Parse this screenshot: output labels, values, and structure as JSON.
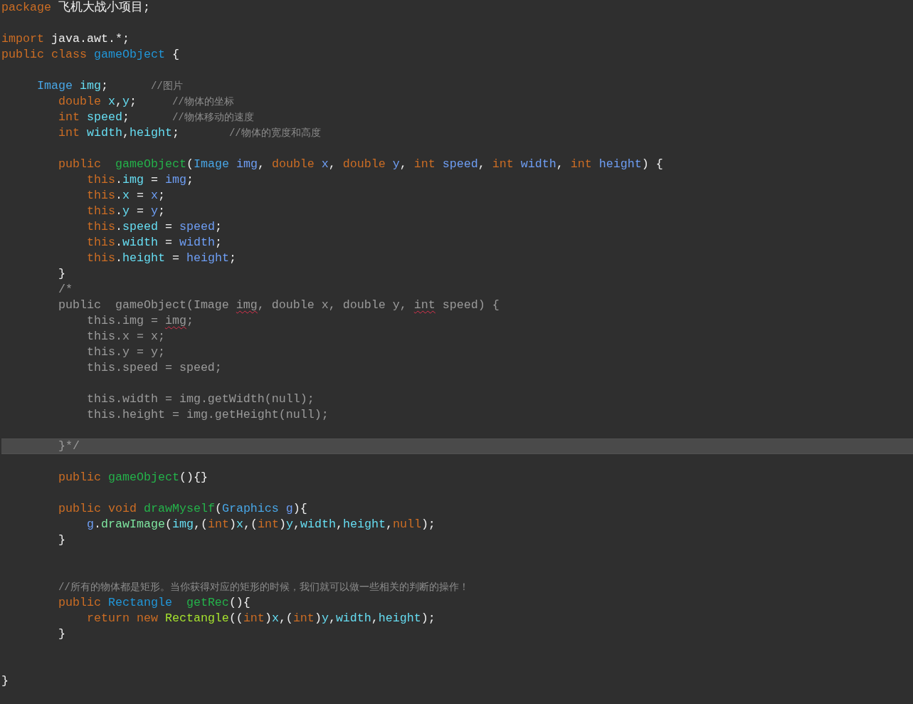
{
  "editor": {
    "lines": [
      {
        "current": false,
        "tokens": [
          {
            "text": "package ",
            "kind": "keyword"
          },
          {
            "text": "飞机大战小项目;",
            "kind": "plain"
          }
        ]
      },
      {
        "current": false
      },
      {
        "current": false,
        "tokens": [
          {
            "text": "import ",
            "kind": "keyword"
          },
          {
            "text": "java.awt.*;",
            "kind": "plain"
          }
        ]
      },
      {
        "current": false,
        "tokens": [
          {
            "text": "public class ",
            "kind": "keyword"
          },
          {
            "text": "gameObject ",
            "kind": "type"
          },
          {
            "text": "{",
            "kind": "plain"
          }
        ]
      },
      {
        "current": false
      },
      {
        "current": false,
        "tokens": [
          {
            "text": "     Image ",
            "kind": "type2"
          },
          {
            "text": "img",
            "kind": "field"
          },
          {
            "text": ";      ",
            "kind": "plain"
          },
          {
            "text": "//图片",
            "kind": "comment"
          }
        ]
      },
      {
        "current": false,
        "tokens": [
          {
            "text": "        double ",
            "kind": "keyword"
          },
          {
            "text": "x",
            "kind": "field"
          },
          {
            "text": ",",
            "kind": "plain"
          },
          {
            "text": "y",
            "kind": "field"
          },
          {
            "text": ";     ",
            "kind": "plain"
          },
          {
            "text": "//物体的坐标",
            "kind": "comment"
          }
        ]
      },
      {
        "current": false,
        "tokens": [
          {
            "text": "        int ",
            "kind": "keyword"
          },
          {
            "text": "speed",
            "kind": "field"
          },
          {
            "text": ";      ",
            "kind": "plain"
          },
          {
            "text": "//物体移动的速度",
            "kind": "comment"
          }
        ]
      },
      {
        "current": false,
        "tokens": [
          {
            "text": "        int ",
            "kind": "keyword"
          },
          {
            "text": "width",
            "kind": "field"
          },
          {
            "text": ",",
            "kind": "plain"
          },
          {
            "text": "height",
            "kind": "field"
          },
          {
            "text": ";       ",
            "kind": "plain"
          },
          {
            "text": "//物体的宽度和高度",
            "kind": "comment"
          }
        ]
      },
      {
        "current": false
      },
      {
        "current": false,
        "tokens": [
          {
            "text": "        public  ",
            "kind": "keyword"
          },
          {
            "text": "gameObject",
            "kind": "method"
          },
          {
            "text": "(",
            "kind": "plain"
          },
          {
            "text": "Image ",
            "kind": "type2"
          },
          {
            "text": "img",
            "kind": "param"
          },
          {
            "text": ", ",
            "kind": "plain"
          },
          {
            "text": "double ",
            "kind": "keyword"
          },
          {
            "text": "x",
            "kind": "param"
          },
          {
            "text": ", ",
            "kind": "plain"
          },
          {
            "text": "double ",
            "kind": "keyword"
          },
          {
            "text": "y",
            "kind": "param"
          },
          {
            "text": ", ",
            "kind": "plain"
          },
          {
            "text": "int ",
            "kind": "keyword"
          },
          {
            "text": "speed",
            "kind": "param"
          },
          {
            "text": ", ",
            "kind": "plain"
          },
          {
            "text": "int ",
            "kind": "keyword"
          },
          {
            "text": "width",
            "kind": "param"
          },
          {
            "text": ", ",
            "kind": "plain"
          },
          {
            "text": "int ",
            "kind": "keyword"
          },
          {
            "text": "height",
            "kind": "param"
          },
          {
            "text": ") {",
            "kind": "plain"
          }
        ]
      },
      {
        "current": false,
        "tokens": [
          {
            "text": "            this",
            "kind": "keyword"
          },
          {
            "text": ".",
            "kind": "plain"
          },
          {
            "text": "img",
            "kind": "field"
          },
          {
            "text": " = ",
            "kind": "plain"
          },
          {
            "text": "img",
            "kind": "param"
          },
          {
            "text": ";",
            "kind": "plain"
          }
        ]
      },
      {
        "current": false,
        "tokens": [
          {
            "text": "            this",
            "kind": "keyword"
          },
          {
            "text": ".",
            "kind": "plain"
          },
          {
            "text": "x",
            "kind": "field"
          },
          {
            "text": " = ",
            "kind": "plain"
          },
          {
            "text": "x",
            "kind": "param"
          },
          {
            "text": ";",
            "kind": "plain"
          }
        ]
      },
      {
        "current": false,
        "tokens": [
          {
            "text": "            this",
            "kind": "keyword"
          },
          {
            "text": ".",
            "kind": "plain"
          },
          {
            "text": "y",
            "kind": "field"
          },
          {
            "text": " = ",
            "kind": "plain"
          },
          {
            "text": "y",
            "kind": "param"
          },
          {
            "text": ";",
            "kind": "plain"
          }
        ]
      },
      {
        "current": false,
        "tokens": [
          {
            "text": "            this",
            "kind": "keyword"
          },
          {
            "text": ".",
            "kind": "plain"
          },
          {
            "text": "speed",
            "kind": "field"
          },
          {
            "text": " = ",
            "kind": "plain"
          },
          {
            "text": "speed",
            "kind": "param"
          },
          {
            "text": ";",
            "kind": "plain"
          }
        ]
      },
      {
        "current": false,
        "tokens": [
          {
            "text": "            this",
            "kind": "keyword"
          },
          {
            "text": ".",
            "kind": "plain"
          },
          {
            "text": "width",
            "kind": "field"
          },
          {
            "text": " = ",
            "kind": "plain"
          },
          {
            "text": "width",
            "kind": "param"
          },
          {
            "text": ";",
            "kind": "plain"
          }
        ]
      },
      {
        "current": false,
        "tokens": [
          {
            "text": "            this",
            "kind": "keyword"
          },
          {
            "text": ".",
            "kind": "plain"
          },
          {
            "text": "height",
            "kind": "field"
          },
          {
            "text": " = ",
            "kind": "plain"
          },
          {
            "text": "height",
            "kind": "param"
          },
          {
            "text": ";",
            "kind": "plain"
          }
        ]
      },
      {
        "current": false,
        "tokens": [
          {
            "text": "        }",
            "kind": "plain"
          }
        ]
      },
      {
        "current": false,
        "tokens": [
          {
            "text": "        /*",
            "kind": "block"
          }
        ]
      },
      {
        "current": false,
        "tokens": [
          {
            "text": "        public  gameObject(Image ",
            "kind": "block"
          },
          {
            "text": "img",
            "kind": "block",
            "misspelled": true
          },
          {
            "text": ", double x, double y, ",
            "kind": "block"
          },
          {
            "text": "int",
            "kind": "block",
            "misspelled": true
          },
          {
            "text": " speed) {",
            "kind": "block"
          }
        ]
      },
      {
        "current": false,
        "tokens": [
          {
            "text": "            this.img = ",
            "kind": "block"
          },
          {
            "text": "img",
            "kind": "block",
            "misspelled": true
          },
          {
            "text": ";",
            "kind": "block"
          }
        ]
      },
      {
        "current": false,
        "tokens": [
          {
            "text": "            this.x = x;",
            "kind": "block"
          }
        ]
      },
      {
        "current": false,
        "tokens": [
          {
            "text": "            this.y = y;",
            "kind": "block"
          }
        ]
      },
      {
        "current": false,
        "tokens": [
          {
            "text": "            this.speed = speed;",
            "kind": "block"
          }
        ]
      },
      {
        "current": false
      },
      {
        "current": false,
        "tokens": [
          {
            "text": "            this.width = img.getWidth(null);",
            "kind": "block"
          }
        ]
      },
      {
        "current": false,
        "tokens": [
          {
            "text": "            this.height = img.getHeight(null);",
            "kind": "block"
          }
        ]
      },
      {
        "current": false
      },
      {
        "current": true,
        "tokens": [
          {
            "text": "        }*/",
            "kind": "block"
          }
        ]
      },
      {
        "current": false
      },
      {
        "current": false,
        "tokens": [
          {
            "text": "        public ",
            "kind": "keyword"
          },
          {
            "text": "gameObject",
            "kind": "method"
          },
          {
            "text": "(){}",
            "kind": "plain"
          }
        ]
      },
      {
        "current": false
      },
      {
        "current": false,
        "tokens": [
          {
            "text": "        public void ",
            "kind": "keyword"
          },
          {
            "text": "drawMyself",
            "kind": "method"
          },
          {
            "text": "(",
            "kind": "plain"
          },
          {
            "text": "Graphics ",
            "kind": "type2"
          },
          {
            "text": "g",
            "kind": "param"
          },
          {
            "text": "){",
            "kind": "plain"
          }
        ]
      },
      {
        "current": false,
        "tokens": [
          {
            "text": "            g",
            "kind": "param"
          },
          {
            "text": ".",
            "kind": "plain"
          },
          {
            "text": "drawImage",
            "kind": "call"
          },
          {
            "text": "(",
            "kind": "plain"
          },
          {
            "text": "img",
            "kind": "field"
          },
          {
            "text": ",(",
            "kind": "plain"
          },
          {
            "text": "int",
            "kind": "keyword"
          },
          {
            "text": ")",
            "kind": "plain"
          },
          {
            "text": "x",
            "kind": "field"
          },
          {
            "text": ",(",
            "kind": "plain"
          },
          {
            "text": "int",
            "kind": "keyword"
          },
          {
            "text": ")",
            "kind": "plain"
          },
          {
            "text": "y",
            "kind": "field"
          },
          {
            "text": ",",
            "kind": "plain"
          },
          {
            "text": "width",
            "kind": "field"
          },
          {
            "text": ",",
            "kind": "plain"
          },
          {
            "text": "height",
            "kind": "field"
          },
          {
            "text": ",",
            "kind": "plain"
          },
          {
            "text": "null",
            "kind": "keyword"
          },
          {
            "text": ");",
            "kind": "plain"
          }
        ]
      },
      {
        "current": false,
        "tokens": [
          {
            "text": "        }",
            "kind": "plain"
          }
        ]
      },
      {
        "current": false
      },
      {
        "current": false
      },
      {
        "current": false,
        "tokens": [
          {
            "text": "        //所有的物体都是矩形。当你获得对应的矩形的时候，我们就可以做一些相关的判断的操作！",
            "kind": "comment"
          }
        ]
      },
      {
        "current": false,
        "tokens": [
          {
            "text": "        public ",
            "kind": "keyword"
          },
          {
            "text": "Rectangle  ",
            "kind": "type"
          },
          {
            "text": "getRec",
            "kind": "method"
          },
          {
            "text": "(){",
            "kind": "plain"
          }
        ]
      },
      {
        "current": false,
        "tokens": [
          {
            "text": "            return new ",
            "kind": "keyword"
          },
          {
            "text": "Rectangle",
            "kind": "ctor"
          },
          {
            "text": "((",
            "kind": "plain"
          },
          {
            "text": "int",
            "kind": "keyword"
          },
          {
            "text": ")",
            "kind": "plain"
          },
          {
            "text": "x",
            "kind": "field"
          },
          {
            "text": ",(",
            "kind": "plain"
          },
          {
            "text": "int",
            "kind": "keyword"
          },
          {
            "text": ")",
            "kind": "plain"
          },
          {
            "text": "y",
            "kind": "field"
          },
          {
            "text": ",",
            "kind": "plain"
          },
          {
            "text": "width",
            "kind": "field"
          },
          {
            "text": ",",
            "kind": "plain"
          },
          {
            "text": "height",
            "kind": "field"
          },
          {
            "text": ");",
            "kind": "plain"
          }
        ]
      },
      {
        "current": false,
        "tokens": [
          {
            "text": "        }",
            "kind": "plain"
          }
        ]
      },
      {
        "current": false
      },
      {
        "current": false
      },
      {
        "current": false,
        "tokens": [
          {
            "text": "}",
            "kind": "plain"
          }
        ]
      }
    ]
  }
}
